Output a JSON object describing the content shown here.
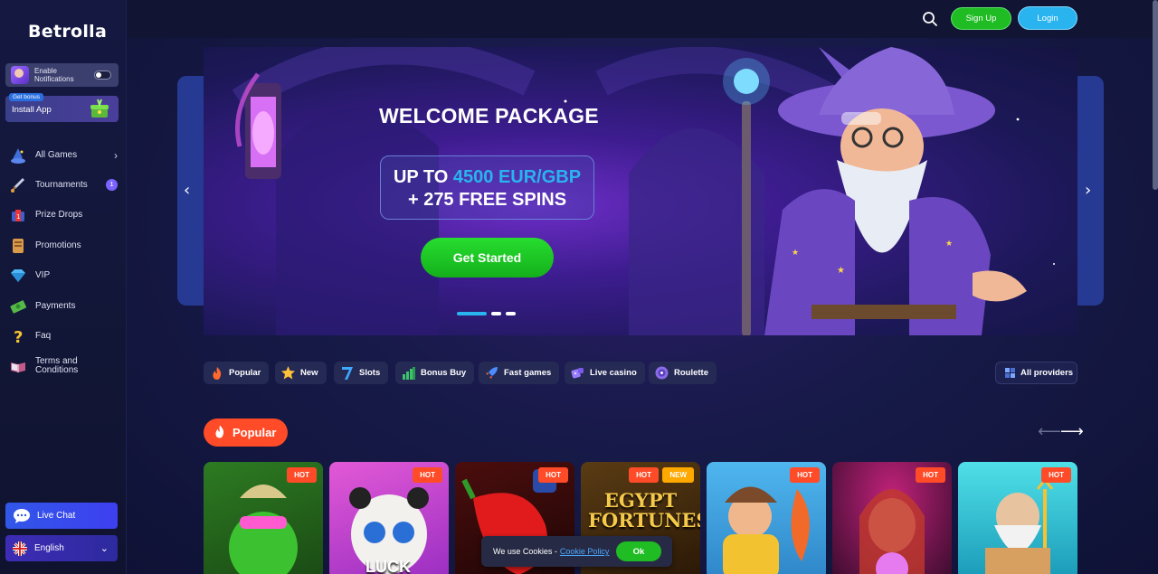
{
  "brand": {
    "logo": "Betrolla"
  },
  "sidebar": {
    "notifications_label": "Enable Notifications",
    "install_badge": "Get bonus",
    "install_label": "Install App",
    "items": [
      {
        "label": "All Games",
        "icon": "wizard-hat-icon",
        "chevron": "›"
      },
      {
        "label": "Tournaments",
        "icon": "sword-icon",
        "badge": "1"
      },
      {
        "label": "Prize Drops",
        "icon": "prize-box-icon"
      },
      {
        "label": "Promotions",
        "icon": "scroll-icon"
      },
      {
        "label": "VIP",
        "icon": "diamond-icon"
      },
      {
        "label": "Payments",
        "icon": "money-icon"
      },
      {
        "label": "Faq",
        "icon": "question-icon"
      },
      {
        "label": "Terms and Conditions",
        "icon": "book-icon"
      }
    ],
    "live_chat": "Live Chat",
    "language": "English"
  },
  "header": {
    "signup": "Sign Up",
    "login": "Login"
  },
  "hero": {
    "title": "WELCOME PACKAGE",
    "offer_prefix": "UP TO ",
    "offer_amount": "4500 EUR/GBP",
    "offer_line2": "+ 275 FREE SPINS",
    "cta": "Get Started",
    "slides": 3,
    "active_slide": 1
  },
  "categories": [
    {
      "label": "Popular",
      "icon": "fire-icon"
    },
    {
      "label": "New",
      "icon": "star-icon"
    },
    {
      "label": "Slots",
      "icon": "seven-icon"
    },
    {
      "label": "Bonus Buy",
      "icon": "chart-icon"
    },
    {
      "label": "Fast games",
      "icon": "rocket-icon"
    },
    {
      "label": "Live casino",
      "icon": "dice-icon"
    },
    {
      "label": "Roulette",
      "icon": "roulette-icon"
    }
  ],
  "providers_label": "All providers",
  "popular_section": {
    "title": "Popular",
    "games": [
      {
        "tags": [
          "HOT"
        ],
        "text": ""
      },
      {
        "tags": [
          "HOT"
        ],
        "text": "LUCK"
      },
      {
        "tags": [
          "HOT"
        ],
        "text": ""
      },
      {
        "tags": [
          "HOT",
          "NEW"
        ],
        "text": "EGYPT FORTUNES"
      },
      {
        "tags": [
          "HOT"
        ],
        "text": ""
      },
      {
        "tags": [
          "HOT"
        ],
        "text": ""
      },
      {
        "tags": [
          "HOT"
        ],
        "text": ""
      }
    ]
  },
  "cookie": {
    "text": "We use Cookies -",
    "link": "Cookie Policy",
    "ok": "Ok"
  }
}
